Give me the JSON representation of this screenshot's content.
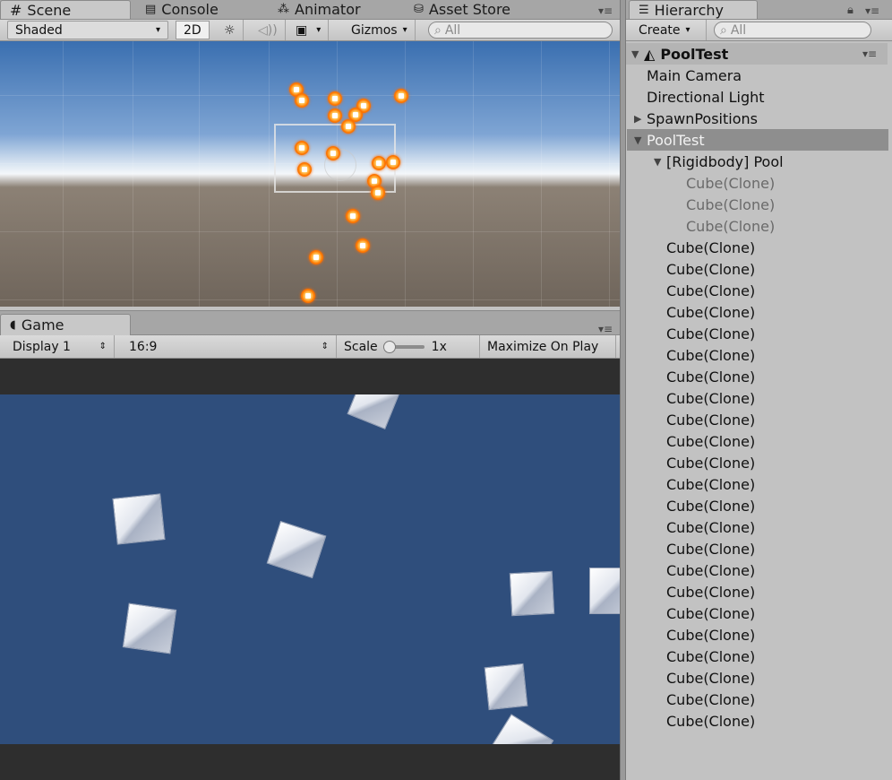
{
  "scene_panel": {
    "tabs": [
      {
        "label": "Scene",
        "icon": "grid-icon"
      },
      {
        "label": "Console",
        "icon": "console-icon"
      },
      {
        "label": "Animator",
        "icon": "animator-icon"
      },
      {
        "label": "Asset Store",
        "icon": "asset-store-icon"
      }
    ],
    "toolbar": {
      "shading_mode": "Shaded",
      "mode_2d": "2D",
      "gizmos_label": "Gizmos",
      "search_placeholder": "All"
    }
  },
  "game_panel": {
    "tab_label": "Game",
    "toolbar": {
      "display": "Display 1",
      "aspect": "16:9",
      "scale_label": "Scale",
      "scale_value": "1x",
      "scale_level": 0,
      "maximize_label": "Maximize On Play"
    }
  },
  "hierarchy_panel": {
    "tab_label": "Hierarchy",
    "create_label": "Create",
    "search_placeholder": "All",
    "scene_name": "PoolTest",
    "items": [
      {
        "label": "Main Camera",
        "depth": 1,
        "expander": "",
        "state": "normal"
      },
      {
        "label": "Directional Light",
        "depth": 1,
        "expander": "",
        "state": "normal"
      },
      {
        "label": "SpawnPositions",
        "depth": 1,
        "expander": "collapsed",
        "state": "normal"
      },
      {
        "label": "PoolTest",
        "depth": 1,
        "expander": "expanded",
        "state": "selected"
      },
      {
        "label": "[Rigidbody] Pool",
        "depth": 2,
        "expander": "expanded",
        "state": "normal"
      },
      {
        "label": "Cube(Clone)",
        "depth": 3,
        "expander": "",
        "state": "inactive"
      },
      {
        "label": "Cube(Clone)",
        "depth": 3,
        "expander": "",
        "state": "inactive"
      },
      {
        "label": "Cube(Clone)",
        "depth": 3,
        "expander": "",
        "state": "inactive"
      },
      {
        "label": "Cube(Clone)",
        "depth": 2,
        "expander": "",
        "state": "normal"
      },
      {
        "label": "Cube(Clone)",
        "depth": 2,
        "expander": "",
        "state": "normal"
      },
      {
        "label": "Cube(Clone)",
        "depth": 2,
        "expander": "",
        "state": "normal"
      },
      {
        "label": "Cube(Clone)",
        "depth": 2,
        "expander": "",
        "state": "normal"
      },
      {
        "label": "Cube(Clone)",
        "depth": 2,
        "expander": "",
        "state": "normal"
      },
      {
        "label": "Cube(Clone)",
        "depth": 2,
        "expander": "",
        "state": "normal"
      },
      {
        "label": "Cube(Clone)",
        "depth": 2,
        "expander": "",
        "state": "normal"
      },
      {
        "label": "Cube(Clone)",
        "depth": 2,
        "expander": "",
        "state": "normal"
      },
      {
        "label": "Cube(Clone)",
        "depth": 2,
        "expander": "",
        "state": "normal"
      },
      {
        "label": "Cube(Clone)",
        "depth": 2,
        "expander": "",
        "state": "normal"
      },
      {
        "label": "Cube(Clone)",
        "depth": 2,
        "expander": "",
        "state": "normal"
      },
      {
        "label": "Cube(Clone)",
        "depth": 2,
        "expander": "",
        "state": "normal"
      },
      {
        "label": "Cube(Clone)",
        "depth": 2,
        "expander": "",
        "state": "normal"
      },
      {
        "label": "Cube(Clone)",
        "depth": 2,
        "expander": "",
        "state": "normal"
      },
      {
        "label": "Cube(Clone)",
        "depth": 2,
        "expander": "",
        "state": "normal"
      },
      {
        "label": "Cube(Clone)",
        "depth": 2,
        "expander": "",
        "state": "normal"
      },
      {
        "label": "Cube(Clone)",
        "depth": 2,
        "expander": "",
        "state": "normal"
      },
      {
        "label": "Cube(Clone)",
        "depth": 2,
        "expander": "",
        "state": "normal"
      },
      {
        "label": "Cube(Clone)",
        "depth": 2,
        "expander": "",
        "state": "normal"
      },
      {
        "label": "Cube(Clone)",
        "depth": 2,
        "expander": "",
        "state": "normal"
      },
      {
        "label": "Cube(Clone)",
        "depth": 2,
        "expander": "",
        "state": "normal"
      },
      {
        "label": "Cube(Clone)",
        "depth": 2,
        "expander": "",
        "state": "normal"
      },
      {
        "label": "Cube(Clone)",
        "depth": 2,
        "expander": "",
        "state": "normal"
      }
    ]
  },
  "colors": {
    "panel_bg": "#c2c2c2",
    "selected_row": "#8e8e8e",
    "game_background": "#2f4e7c",
    "gizmo_orange": "#ff7a00"
  }
}
